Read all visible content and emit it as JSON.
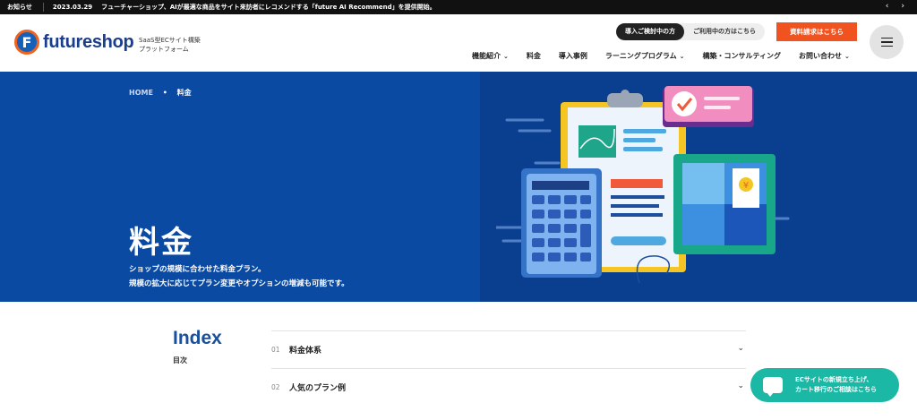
{
  "newsbar": {
    "label": "お知らせ",
    "date": "2023.03.29",
    "text": "フューチャーショップ、AIが最適な商品をサイト来訪者にレコメンドする「future AI Recommend」を提供開始。",
    "prev_icon": "chevron-left-icon",
    "next_icon": "chevron-right-icon"
  },
  "header": {
    "logo_mark": "F",
    "logo_text": "futureshop",
    "tagline_line1": "SaaS型ECサイト構築",
    "tagline_line2": "プラットフォーム",
    "pill_active": "導入ご検討中の方",
    "pill_inactive": "ご利用中の方はこちら",
    "cta_label": "資料請求はこちら",
    "menu_icon": "hamburger-icon"
  },
  "nav": {
    "items": [
      {
        "label": "機能紹介",
        "has_chevron": true
      },
      {
        "label": "料金",
        "has_chevron": false
      },
      {
        "label": "導入事例",
        "has_chevron": false
      },
      {
        "label": "ラーニングプログラム",
        "has_chevron": true
      },
      {
        "label": "構築・コンサルティング",
        "has_chevron": false
      },
      {
        "label": "お問い合わせ",
        "has_chevron": true
      }
    ],
    "chevron": "⌄"
  },
  "hero": {
    "breadcrumb_home": "HOME",
    "breadcrumb_sep": "•",
    "breadcrumb_current": "料金",
    "title": "料金",
    "desc_line1": "ショップの規模に合わせた料金プラン。",
    "desc_line2": "規模の拡大に応じてプラン変更やオプションの増減も可能です。",
    "coin_label": "¥",
    "colors": {
      "hero_bg": "#0b4aa3",
      "accent": "#f0531f"
    }
  },
  "index": {
    "title": "Index",
    "subtitle": "目次",
    "rows": [
      {
        "num": "01",
        "label": "料金体系"
      },
      {
        "num": "02",
        "label": "人気のプラン例"
      }
    ],
    "arrow_glyph": "⌄"
  },
  "chat": {
    "line1": "ECサイトの新規立ち上げ、",
    "line2": "カート移行のご相談はこちら",
    "icon": "chat-bubble-icon"
  }
}
